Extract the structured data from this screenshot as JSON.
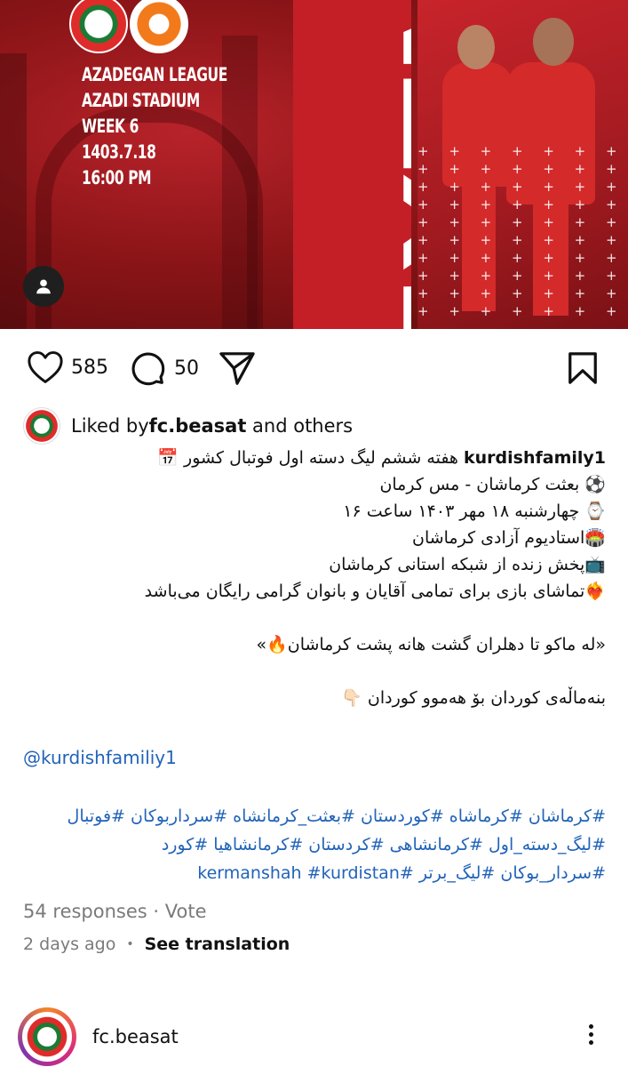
{
  "post": {
    "image": {
      "match_info": [
        "AZADEGAN LEAGUE",
        "AZADI STADIUM",
        "WEEK 6",
        "1403.7.18",
        "16:00 PM"
      ],
      "vertical_text": "NEXTM",
      "plus_rows": [
        "+ + + + + + +",
        "+ + + + + + +",
        "+ + + + + + +",
        "+ + + + + + +",
        "+ + + + + + +",
        "+ + + + + + +",
        "+ + + + + + +",
        "+ + + + + + +",
        "+ + + + + + +",
        "+ + + + + + +"
      ]
    },
    "actions": {
      "likes_count": "585",
      "comments_count": "50"
    },
    "liked_by": {
      "prefix": "Liked by ",
      "user": "fc.beasat",
      "suffix": " and others"
    },
    "caption": {
      "username": "kurdishfamily1",
      "lines": [
        "هفته ششم لیگ دسته اول فوتبال کشور 📅",
        "⚽ بعثت کرماشان - مس کرمان",
        "⌚ چهارشنبه ۱۸ مهر ۱۴۰۳ ساعت ۱۶",
        "🏟️استادیوم آزادی کرماشان",
        "📺پخش زنده از شبکه استانی کرماشان",
        "❤️‍🔥تماشای بازی برای تمامی آقایان و بانوان گرامی رایگان می‌باشد"
      ],
      "quote": "«له ماکو تا دهلران گشت هانه پشت کرماشان🔥»",
      "kurdish_line": "بنه‌ماڵه‌ی کوردان بۆ هه‌موو کوردان 👇🏻",
      "mention": "@kurdishfamiliy1",
      "hashtag_lines": [
        "#کرماشان #کرماشاه #کوردستان #بعثت_کرمانشاه #سرداربوکان #فوتبال",
        "#لیگ_دسته_اول #کرمانشاهی #کردستان #کرمانشاهیا #کورد",
        "#سردار_بوکان #لیگ_برتر #kermanshah #kurdistan"
      ]
    },
    "responses": "54 responses · Vote",
    "time_ago": "2 days ago",
    "see_translation": "See translation"
  },
  "next_post": {
    "username": "fc.beasat"
  }
}
